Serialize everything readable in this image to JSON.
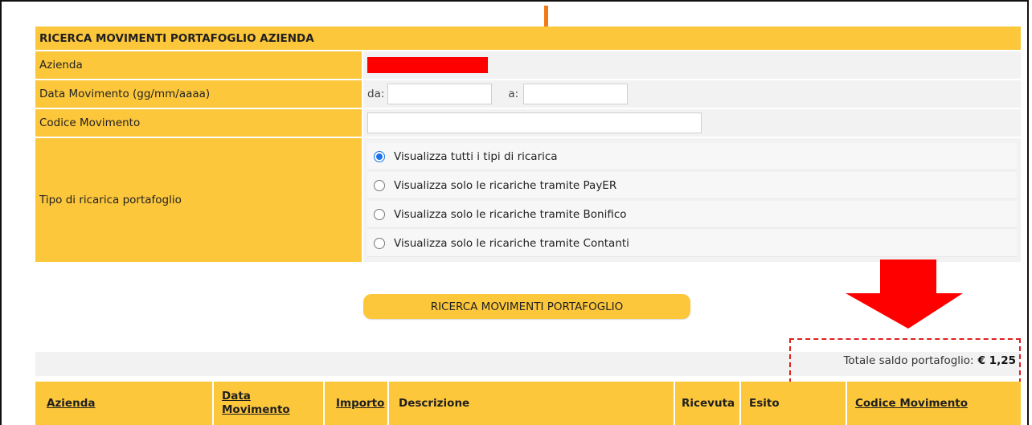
{
  "form": {
    "title": "RICERCA MOVIMENTI PORTAFOGLIO AZIENDA",
    "azienda_label": "Azienda",
    "data_label": "Data Movimento (gg/mm/aaaa)",
    "da_label": "da:",
    "a_label": "a:",
    "da_value": "",
    "a_value": "",
    "codice_label": "Codice Movimento",
    "codice_value": "",
    "tipo_label": "Tipo di ricarica portafoglio",
    "radio_options": [
      {
        "label": "Visualizza tutti i tipi di ricarica",
        "checked": true
      },
      {
        "label": "Visualizza solo le ricariche tramite PayER",
        "checked": false
      },
      {
        "label": "Visualizza solo le ricariche tramite Bonifico",
        "checked": false
      },
      {
        "label": "Visualizza solo le ricariche tramite Contanti",
        "checked": false
      }
    ]
  },
  "search_button": "RICERCA MOVIMENTI PORTAFOGLIO",
  "saldo": {
    "label": "Totale saldo portafoglio:",
    "value": "€ 1,25"
  },
  "results": {
    "columns": [
      "Azienda",
      "Data Movimento",
      "Importo",
      "Descrizione",
      "Ricevuta",
      "Esito",
      "Codice Movimento"
    ],
    "sortable": [
      true,
      true,
      true,
      false,
      false,
      false,
      true
    ]
  },
  "colors": {
    "header_yellow": "#fdc73b",
    "redaction": "#ff0000",
    "annotation_red": "#e02020",
    "radio_blue": "#1a73e8"
  }
}
